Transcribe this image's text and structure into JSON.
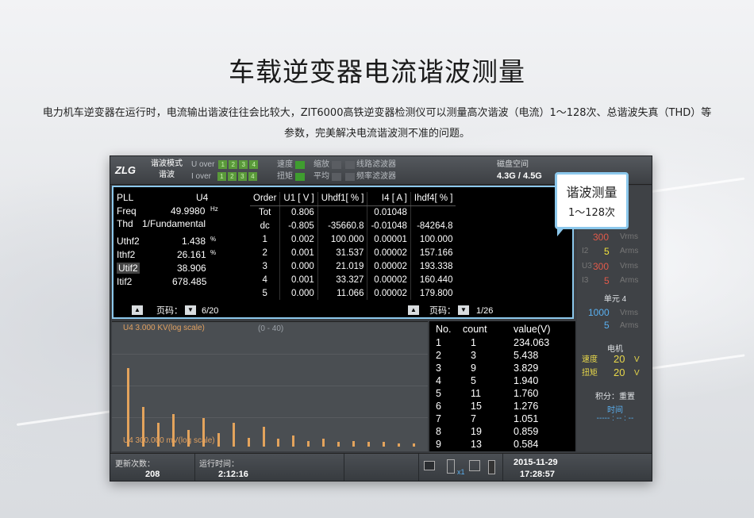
{
  "heading": "车载逆变器电流谐波测量",
  "description": {
    "line1": "电力机车逆变器在运行时，电流输出谐波往往会比较大，ZIT6000高铁逆变器检测仪可以测量高次谐波（电流）1～128次、总谐波失真（THD）等",
    "line2": "参数，完美解决电流谐波测不准的问题。"
  },
  "callout": {
    "title": "谐波测量",
    "range": "1～128次"
  },
  "instrument": {
    "logo": "ZLG",
    "mode_line1": "谐波模式",
    "mode_line2": "谐波",
    "u_over_label": "U over",
    "i_over_label": "I over",
    "channel_numbers": [
      "1",
      "2",
      "3",
      "4"
    ],
    "speed_label": "速度",
    "torque_label": "扭矩",
    "zoom_label": "缩放",
    "average_label": "平均",
    "line_filter_label": "线路滤波器",
    "freq_filter_label": "频率滤波器",
    "disk_label": "磁盘空间",
    "disk_value": "4.3G / 4.5G",
    "left_params": {
      "pll_label": "PLL",
      "pll_value": "U4",
      "freq_label": "Freq",
      "freq_value": "49.9980",
      "freq_unit": "Hz",
      "thd_label": "Thd",
      "thd_value": "1/Fundamental",
      "uthf_label": "Uthf2",
      "uthf_value": "1.438",
      "uthf_unit": "%",
      "ithf_label": "Ithf2",
      "ithf_value": "26.161",
      "ithf_unit": "%",
      "utif_label": "Utif2",
      "utif_value": "38.906",
      "itif_label": "Itif2",
      "itif_value": "678.485"
    },
    "harmonic_table": {
      "headers": [
        "Order",
        "U1 [ V ]",
        "Uhdf1[ % ]",
        "I4 [ A ]",
        "Ihdf4[ % ]"
      ],
      "rows": [
        [
          "Tot",
          "0.806",
          "",
          "0.01048",
          ""
        ],
        [
          "dc",
          "-0.805",
          "-35660.8",
          "-0.01048",
          "-84264.8"
        ],
        [
          "1",
          "0.002",
          "100.000",
          "0.00001",
          "100.000"
        ],
        [
          "2",
          "0.001",
          "31.537",
          "0.00002",
          "157.166"
        ],
        [
          "3",
          "0.000",
          "21.019",
          "0.00002",
          "193.338"
        ],
        [
          "4",
          "0.001",
          "33.327",
          "0.00002",
          "160.440"
        ],
        [
          "5",
          "0.000",
          "11.066",
          "0.00002",
          "179.800"
        ]
      ]
    },
    "pager_label": "页码：",
    "pager_left": "6/20",
    "pager_right": "1/26",
    "right_column": {
      "unit_label": "单元 4",
      "u4_value": "1000",
      "u4_unit": "Vrms",
      "i4_value": "5",
      "i4_unit": "Arms",
      "i2_label": "I2",
      "i2_value": "5",
      "i2_unit": "Arms",
      "u3_label": "U3",
      "u3_value": "300",
      "u3_unit": "Vrms",
      "i3_label": "I3",
      "i3_value": "5",
      "i3_unit": "Arms",
      "u2_value": "300",
      "u2_unit": "Vrms",
      "motor_label": "电机",
      "speed_label": "速度",
      "speed_value": "20",
      "speed_unit": "V",
      "torque_label": "扭矩",
      "torque_value": "20",
      "torque_unit": "V",
      "integral_label": "积分：重置",
      "time_label": "时间",
      "time_value": "----- : -- : --"
    },
    "chart": {
      "top_label": "U4   3.000 KV(log scale)",
      "range_label": "(0 - 40)",
      "bottom_label": "U4   300.000 mV(log scale)"
    },
    "count_table": {
      "headers": [
        "No.",
        "count",
        "value(V)"
      ],
      "rows": [
        [
          "1",
          "1",
          "234.063"
        ],
        [
          "2",
          "3",
          "5.438"
        ],
        [
          "3",
          "9",
          "3.829"
        ],
        [
          "4",
          "5",
          "1.940"
        ],
        [
          "5",
          "11",
          "1.760"
        ],
        [
          "6",
          "15",
          "1.276"
        ],
        [
          "7",
          "7",
          "1.051"
        ],
        [
          "8",
          "19",
          "0.859"
        ],
        [
          "9",
          "13",
          "0.584"
        ]
      ]
    },
    "footer": {
      "update_label": "更新次数：",
      "update_value": "208",
      "runtime_label": "运行时间：",
      "runtime_value": "2:12:16",
      "usb_label": "x1",
      "date": "2015-11-29",
      "time": "17:28:57"
    }
  },
  "chart_data": {
    "type": "bar",
    "x": [
      1,
      3,
      5,
      7,
      9,
      11,
      13,
      15,
      17,
      19,
      21,
      23,
      25,
      27,
      29,
      31,
      33,
      35,
      37,
      39
    ],
    "values": [
      0.72,
      0.36,
      0.22,
      0.3,
      0.15,
      0.26,
      0.12,
      0.22,
      0.08,
      0.18,
      0.07,
      0.1,
      0.05,
      0.07,
      0.04,
      0.05,
      0.04,
      0.04,
      0.03,
      0.03
    ],
    "xlim": [
      0,
      40
    ],
    "ylabel": "U4",
    "colors": {
      "bar": "#e3a35c"
    }
  }
}
